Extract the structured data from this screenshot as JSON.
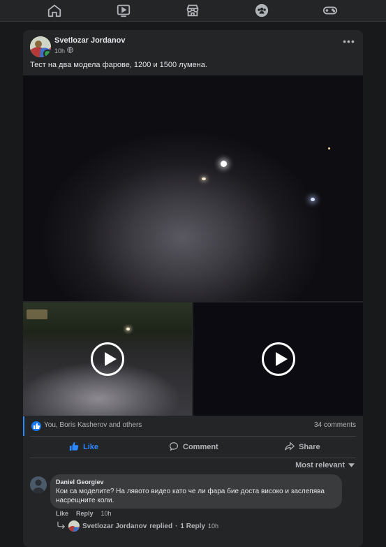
{
  "nav": {
    "icons": [
      "home-icon",
      "watch-icon",
      "marketplace-icon",
      "groups-icon",
      "gaming-icon"
    ]
  },
  "post": {
    "author": "Svetlozar Jordanov",
    "time": "10h",
    "privacy_icon": "globe-icon",
    "text": "Тест на два модела фарове, 1200 и 1500 лумена."
  },
  "reactions": {
    "summary": "You, Boris Kasherov and others",
    "comments_count": "34 comments"
  },
  "actions": {
    "like": "Like",
    "comment": "Comment",
    "share": "Share"
  },
  "comments_sort": "Most relevant",
  "comment": {
    "author": "Daniel Georgiev",
    "text": "Кои са моделите? На лявото видео като че ли фара бие доста високо и заслепява насрещните коли.",
    "like": "Like",
    "reply": "Reply",
    "time": "10h"
  },
  "replies": {
    "author": "Svetlozar Jordanov",
    "text": "replied",
    "separator": "·",
    "count": "1 Reply",
    "time": "10h"
  },
  "colors": {
    "accent": "#2d88ff",
    "background": "#18191a",
    "card": "#242526",
    "bubble": "#3a3b3c"
  }
}
